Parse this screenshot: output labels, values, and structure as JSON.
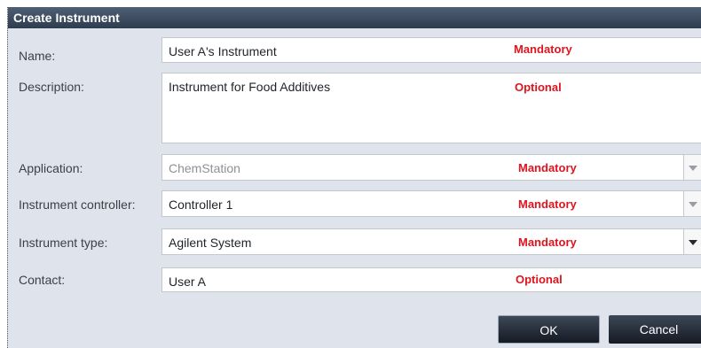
{
  "dialog": {
    "title": "Create Instrument",
    "fields": {
      "name": {
        "label": "Name:",
        "value": "User A's Instrument",
        "requirement": "Mandatory"
      },
      "description": {
        "label": "Description:",
        "value": "Instrument for Food Additives",
        "requirement": "Optional"
      },
      "application": {
        "label": "Application:",
        "value": "ChemStation",
        "requirement": "Mandatory"
      },
      "controller": {
        "label": "Instrument controller:",
        "value": "Controller 1",
        "requirement": "Mandatory"
      },
      "type": {
        "label": "Instrument type:",
        "value": "Agilent System",
        "requirement": "Mandatory"
      },
      "contact": {
        "label": "Contact:",
        "value": "User A",
        "requirement": "Optional"
      }
    },
    "buttons": {
      "ok": "OK",
      "cancel": "Cancel"
    },
    "colors": {
      "requirement": "#e0141e",
      "titlebar": "#3a4659",
      "background": "#dfe3eb"
    }
  }
}
